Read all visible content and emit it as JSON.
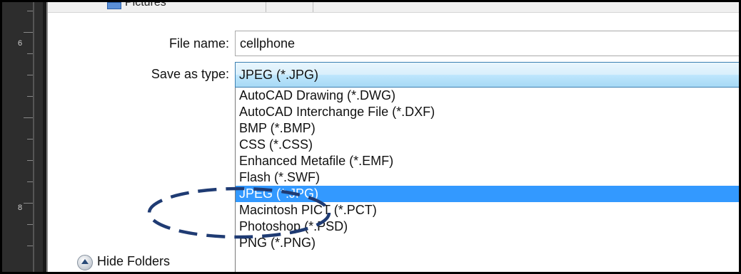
{
  "ruler": {
    "marks": [
      "6",
      "8"
    ]
  },
  "toolbar": {
    "folder_label": "Pictures"
  },
  "form": {
    "file_name_label": "File name:",
    "file_name_value": "cellphone",
    "save_as_type_label": "Save as type:",
    "save_as_type_value": "JPEG (*.JPG)"
  },
  "dropdown": {
    "options": [
      "AutoCAD Drawing (*.DWG)",
      "AutoCAD Interchange File (*.DXF)",
      "BMP (*.BMP)",
      "CSS (*.CSS)",
      "Enhanced Metafile (*.EMF)",
      "Flash (*.SWF)",
      "JPEG (*.JPG)",
      "Macintosh PICT (*.PCT)",
      "Photoshop (*.PSD)",
      "PNG (*.PNG)"
    ],
    "selected_index": 6
  },
  "footer": {
    "hide_folders_label": "Hide Folders"
  },
  "colors": {
    "selection": "#3399ff",
    "annotation": "#1f3b73"
  }
}
